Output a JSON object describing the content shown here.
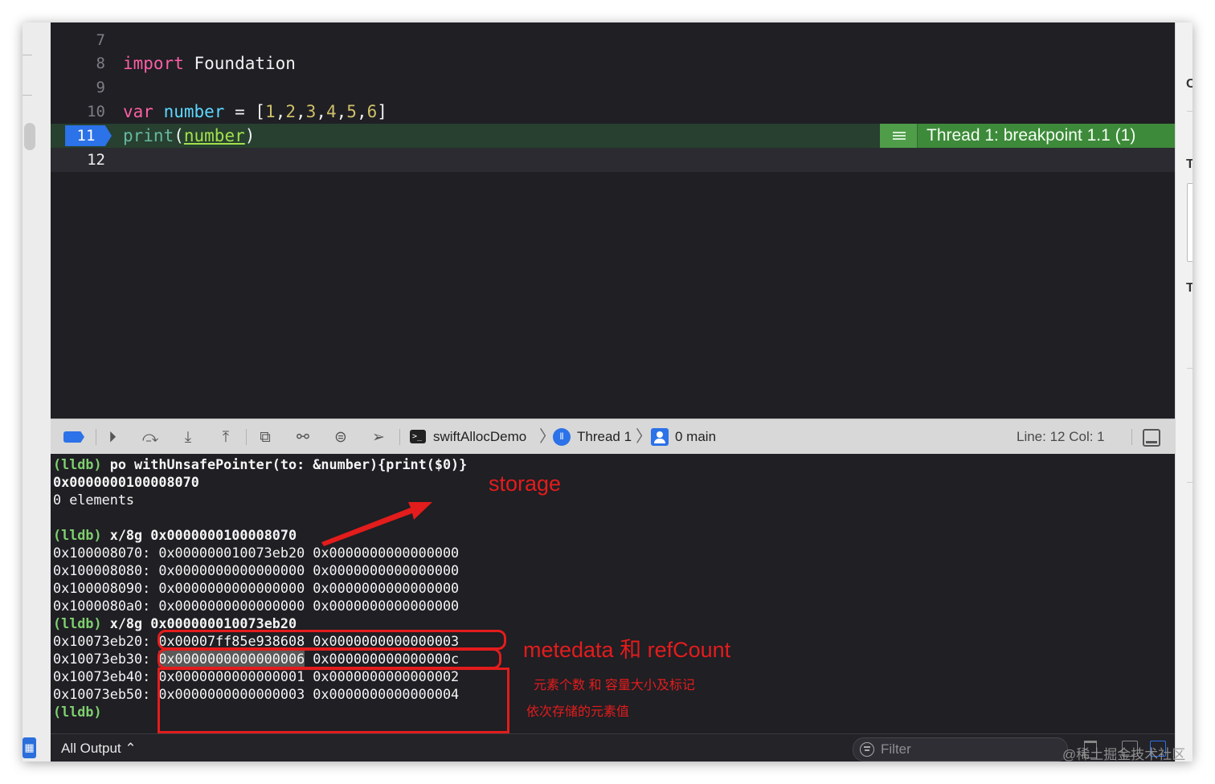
{
  "editor": {
    "lines": [
      {
        "num": "7"
      },
      {
        "num": "8",
        "kw": "import",
        "rest": " Foundation"
      },
      {
        "num": "9"
      },
      {
        "num": "10",
        "kw": "var",
        "name": "number",
        "eq": " = ",
        "open": "[",
        "n1": "1",
        "n2": "2",
        "n3": "3",
        "n4": "4",
        "n5": "5",
        "n6": "6",
        "close": "]",
        "comma": ","
      },
      {
        "num": "11",
        "fn": "print",
        "lp": "(",
        "arg": "number",
        "rp": ")"
      },
      {
        "num": "12"
      }
    ],
    "breakpoint_banner": "Thread 1: breakpoint 1.1 (1)"
  },
  "debug_bar": {
    "target": "swiftAllocDemo",
    "thread": "Thread 1",
    "frame": "0 main",
    "position": "Line: 12  Col: 1",
    "icons": [
      "breakpoint-toggle-icon",
      "continue-icon",
      "step-over-icon",
      "step-into-icon",
      "step-out-icon",
      "view-hierarchy-icon",
      "memory-graph-icon",
      "environment-icon",
      "location-icon"
    ]
  },
  "console": {
    "prompt": "(lldb)",
    "lines": [
      {
        "prompt": true,
        "cmd": " po withUnsafePointer(to: &number){print($0)}",
        "bold": true
      },
      {
        "text": "0x0000000100008070",
        "bold": true
      },
      {
        "text": "0 elements"
      },
      {
        "text": ""
      },
      {
        "prompt": true,
        "cmd": " x/8g 0x0000000100008070",
        "bold": true
      },
      {
        "text": "0x100008070: 0x000000010073eb20 0x0000000000000000"
      },
      {
        "text": "0x100008080: 0x0000000000000000 0x0000000000000000"
      },
      {
        "text": "0x100008090: 0x0000000000000000 0x0000000000000000"
      },
      {
        "text": "0x1000080a0: 0x0000000000000000 0x0000000000000000"
      },
      {
        "prompt": true,
        "cmd": " x/8g 0x000000010073eb20",
        "bold": true
      },
      {
        "text": "0x10073eb20: 0x00007ff85e938608 0x0000000000000003"
      },
      {
        "addr": "0x10073eb30: ",
        "hl": "0x0000000000000006",
        "tail": " 0x000000000000000c"
      },
      {
        "text": "0x10073eb40: 0x0000000000000001 0x0000000000000002"
      },
      {
        "text": "0x10073eb50: 0x0000000000000003 0x0000000000000004"
      },
      {
        "prompt": true,
        "cmd": "",
        "bold": true
      }
    ]
  },
  "annotations": {
    "storage": "storage",
    "metadata": "metedata 和 refCount",
    "count_capacity": "元素个数 和 容量大小及标记",
    "elements": "依次存储的元素值",
    "color": "#e31c1c"
  },
  "bottom_bar": {
    "output_select": "All Output ⌃",
    "filter_placeholder": "Filter"
  },
  "watermark": "@稀土掘金技术社区"
}
